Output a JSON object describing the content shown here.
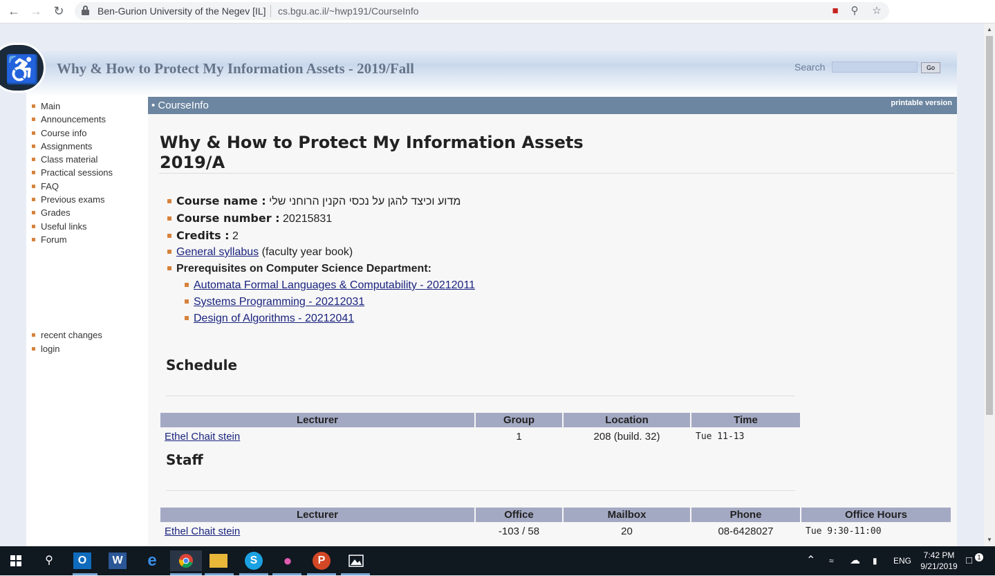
{
  "browser": {
    "site_name": "Ben-Gurion University of the Negev [IL]",
    "url": "cs.bgu.ac.il/~hwp191/CourseInfo"
  },
  "header": {
    "title": "Why & How to Protect My Information Assets - 2019/Fall",
    "search_label": "Search",
    "go_label": "Go"
  },
  "sidebar": {
    "items": [
      "Main",
      "Announcements",
      "Course info",
      "Assignments",
      "Class material",
      "Practical sessions",
      "FAQ",
      "Previous exams",
      "Grades",
      "Useful links",
      "Forum"
    ],
    "extra": [
      "recent changes",
      "login"
    ]
  },
  "content_bar": {
    "crumb": "• CourseInfo",
    "printable": "printable version"
  },
  "page": {
    "title_line1": "Why & How to Protect My Information Assets",
    "title_line2": "2019/A"
  },
  "course": {
    "name_label": "Course name :",
    "name_value": "מדוע וכיצד להגן על נכסי הקנין הרוחני שלי",
    "number_label": "Course number :",
    "number_value": "20215831",
    "credits_label": "Credits :",
    "credits_value": "2",
    "syllabus_link": "General syllabus",
    "syllabus_note": "(faculty year book)",
    "prereq_label": "Prerequisites on Computer Science Department:",
    "prerequisites": [
      "Automata Formal Languages & Computability - 20212011",
      "Systems Programming - 20212031",
      "Design of Algorithms - 20212041"
    ]
  },
  "schedule": {
    "title": "Schedule",
    "headers": [
      "Lecturer",
      "Group",
      "Location",
      "Time"
    ],
    "rows": [
      [
        "Ethel Chait stein",
        "1",
        "208 (build. 32)",
        "Tue 11-13"
      ]
    ]
  },
  "staff": {
    "title": "Staff",
    "headers": [
      "Lecturer",
      "Office",
      "Mailbox",
      "Phone",
      "Office Hours"
    ],
    "rows": [
      [
        "Ethel Chait stein",
        "-103 / 58",
        "20",
        "08-6428027",
        "Tue 9:30-11:00"
      ]
    ]
  },
  "taskbar": {
    "language": "ENG",
    "time": "7:42 PM",
    "date": "9/21/2019",
    "notifications": "1"
  }
}
